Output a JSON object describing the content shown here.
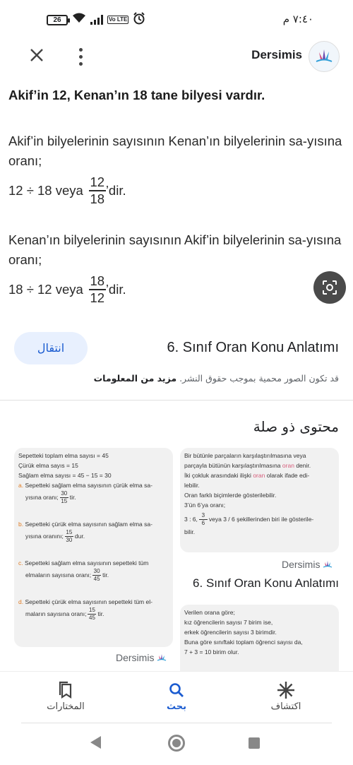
{
  "status_bar": {
    "battery": "26",
    "volte": "Vo LTE",
    "time": "٧:٤٠ م"
  },
  "header": {
    "site_name": "Dersimis"
  },
  "preview": {
    "title": "Akif’in 12, Kenan’ın 18 tane bilyesi vardır.",
    "text1": "Akif’in bilyelerinin sayısının Kenan’ın bilyelerinin sa-yısına oranı;",
    "eq1_left": "12 ÷ 18  veya",
    "eq1_num": "12",
    "eq1_den": "18",
    "eq1_suffix": "’dir.",
    "text2": "Kenan’ın bilyelerinin sayısının Akif’in bilyelerinin sa-yısına oranı;",
    "eq2_left": "18 ÷ 12  veya",
    "eq2_num": "18",
    "eq2_den": "12",
    "eq2_suffix": "’dir."
  },
  "result": {
    "visit_label": "انتقال",
    "title": "6. Sınıf Oran Konu Anlatımı",
    "copyright_text": "قد تكون الصور محمية بموجب حقوق النشر.",
    "more_info": "مزيد من المعلومات"
  },
  "related": {
    "title": "محتوى ذو صلة",
    "card1": {
      "l1": "Sepetteki toplam elma sayısı = 45",
      "l2": "Çürük elma sayıs = 15",
      "l3": "Sağlam elma sayısı = 45 − 15 = 30",
      "a_text": "Sepetteki sağlam elma sayısının çürük elma sa-",
      "a_text2": "yısına oranı;",
      "a_num": "30",
      "a_den": "15",
      "a_suffix": "tir.",
      "b_text": "Sepetteki çürük elma sayısının sağlam elma sa-",
      "b_text2": "yısına oranını;",
      "b_num": "15",
      "b_den": "30",
      "b_suffix": "dur.",
      "c_text": "Sepetteki sağlam elma sayısının sepetteki tüm",
      "c_text2": "elmaların sayısına oranı;",
      "c_num": "30",
      "c_den": "45",
      "c_suffix": "tir.",
      "d_text": "Sepetteki çürük elma sayısının sepetteki tüm el-",
      "d_text2": "maların sayısına oranı;",
      "d_num": "15",
      "d_den": "45",
      "d_suffix": "tir.",
      "mark_a": "a.",
      "mark_b": "b.",
      "mark_c": "c.",
      "mark_d": "d."
    },
    "card1_source": "Dersimis",
    "card2": {
      "l1a": "Bir bütünle parçaların karşılaştırılmasına veya",
      "l1b_pre": "parçayla bütünün karşılaştırılmasına",
      "l1b_kw": "oran",
      "l1b_post": "denir.",
      "l2a_pre": "İki çokluk arasındaki ilişki",
      "l2a_kw": "oran",
      "l2a_post": "olarak ifade edi-",
      "l2b": "lebilir.",
      "l3": "Oran farklı biçimlerde gösterilebilir.",
      "l4": "3’ün 6’ya oranı;",
      "l5_pre": "3 : 6,",
      "l5_num": "3",
      "l5_den": "6",
      "l5_post": "veya 3 / 6 şekillerinden biri ile gösterile-",
      "l6": "bilir."
    },
    "card2_source": "Dersimis",
    "card2_title": "6. Sınıf Oran Konu Anlatımı",
    "card3": {
      "l1": "Verilen orana göre;",
      "l2": "kız öğrencilerin sayısı 7 birim ise,",
      "l3": "erkek öğrencilerin sayısı 3 birimdir.",
      "l4": "Buna göre sınıftaki toplam öğrenci sayısı da,",
      "l5": "7 + 3 = 10 birim olur."
    }
  },
  "bottom_nav": {
    "saved": "المختارات",
    "search": "بحث",
    "discover": "اكتشاف"
  },
  "colors": {
    "accent": "#1a5bd0",
    "visit_bg": "#e8f0fe",
    "card_bg": "#f1f1f1"
  }
}
